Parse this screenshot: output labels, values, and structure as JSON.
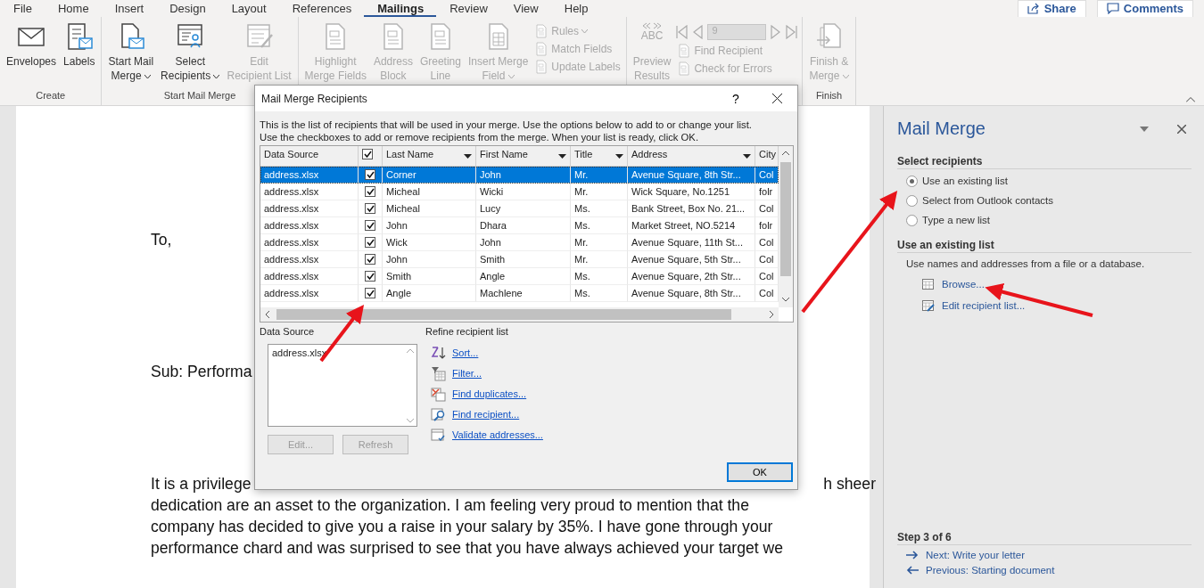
{
  "menu_tabs": [
    {
      "label": "File",
      "selected": false
    },
    {
      "label": "Home",
      "selected": false
    },
    {
      "label": "Insert",
      "selected": false
    },
    {
      "label": "Design",
      "selected": false
    },
    {
      "label": "Layout",
      "selected": false
    },
    {
      "label": "References",
      "selected": false
    },
    {
      "label": "Mailings",
      "selected": true
    },
    {
      "label": "Review",
      "selected": false
    },
    {
      "label": "View",
      "selected": false
    },
    {
      "label": "Help",
      "selected": false
    }
  ],
  "header_buttons": [
    {
      "label": "Share"
    },
    {
      "label": "Comments"
    }
  ],
  "ribbon_groups": [
    {
      "label": "Create",
      "commands": [
        {
          "kind": "large",
          "lines": [
            "Envelopes"
          ],
          "dropdown": false,
          "disabled": false
        },
        {
          "kind": "large",
          "lines": [
            "Labels"
          ],
          "dropdown": false,
          "disabled": false
        }
      ]
    },
    {
      "label": "Start Mail Merge",
      "commands": [
        {
          "kind": "large",
          "lines": [
            "Start Mail",
            "Merge"
          ],
          "dropdown": true,
          "disabled": false
        },
        {
          "kind": "large",
          "lines": [
            "Select",
            "Recipients"
          ],
          "dropdown": true,
          "disabled": false
        },
        {
          "kind": "large",
          "lines": [
            "Edit",
            "Recipient List"
          ],
          "dropdown": false,
          "disabled": true
        }
      ]
    },
    {
      "commands": [
        {
          "kind": "large",
          "lines": [
            "Highlight",
            "Merge Fields"
          ],
          "dropdown": false,
          "disabled": true
        },
        {
          "kind": "large",
          "lines": [
            "Address",
            "Block"
          ],
          "dropdown": false,
          "disabled": true
        },
        {
          "kind": "large",
          "lines": [
            "Greeting",
            "Line"
          ],
          "dropdown": false,
          "disabled": true
        },
        {
          "kind": "large",
          "lines": [
            "Insert Merge",
            "Field"
          ],
          "dropdown": true,
          "disabled": true
        },
        {
          "kind": "small",
          "lines": [
            "Rules"
          ],
          "dropdown": true,
          "disabled": true
        },
        {
          "kind": "small",
          "lines": [
            "Match Fields"
          ],
          "dropdown": false,
          "disabled": true
        },
        {
          "kind": "small",
          "lines": [
            "Update Labels"
          ],
          "dropdown": false,
          "disabled": true
        }
      ]
    },
    {
      "commands": [
        {
          "kind": "large",
          "badge": "ABC",
          "lines": [
            "Preview",
            "Results"
          ],
          "dropdown": false,
          "disabled": true
        },
        {
          "kind": "nav",
          "record": "9",
          "disabled": true
        },
        {
          "kind": "small",
          "lines": [
            "Find Recipient"
          ],
          "dropdown": false,
          "disabled": true
        },
        {
          "kind": "small",
          "lines": [
            "Check for Errors"
          ],
          "dropdown": false,
          "disabled": true
        }
      ]
    },
    {
      "label": "Finish",
      "commands": [
        {
          "kind": "large",
          "lines": [
            "Finish &",
            "Merge"
          ],
          "dropdown": true,
          "disabled": true
        }
      ]
    }
  ],
  "document": {
    "greeting": "To,",
    "subject": "Sub: Performa",
    "first_line_left": "It is a privilege",
    "first_line_right": "h sheer",
    "lines": [
      "dedication are an asset to the organization. I am feeling very proud to mention that the",
      "company has decided to give you a raise in your salary by 35%. I have gone through your",
      "performance chard and was surprised to see that you have always achieved your target we"
    ]
  },
  "dialog": {
    "title": "Mail Merge Recipients",
    "help": "?",
    "intro_lines": [
      "This is the list of recipients that will be used in your merge.  Use the options below to add to or change your list.",
      "Use the checkboxes to add or remove recipients from the merge.  When your list is ready, click OK."
    ],
    "columns": [
      {
        "label": "Data Source",
        "kind": "text",
        "sortable": false
      },
      {
        "kind": "check",
        "checked": true
      },
      {
        "label": "Last Name",
        "kind": "text",
        "sortable": true
      },
      {
        "label": "First Name",
        "kind": "text",
        "sortable": true
      },
      {
        "label": "Title",
        "kind": "text",
        "sortable": true
      },
      {
        "label": "Address",
        "kind": "text",
        "sortable": true
      },
      {
        "label": "City",
        "kind": "text",
        "sortable": false
      }
    ],
    "rows": [
      {
        "source": "address.xlsx",
        "checked": true,
        "last": "Corner",
        "first": "John",
        "title": "Mr.",
        "address": "Avenue Square, 8th Str...",
        "city": "Col",
        "selected": true
      },
      {
        "source": "address.xlsx",
        "checked": true,
        "last": "Micheal",
        "first": "Wicki",
        "title": "Mr.",
        "address": "Wick Square, No.1251",
        "city": "folr",
        "selected": false
      },
      {
        "source": "address.xlsx",
        "checked": true,
        "last": "Micheal",
        "first": "Lucy",
        "title": "Ms.",
        "address": "Bank Street, Box No. 21...",
        "city": "Col",
        "selected": false
      },
      {
        "source": "address.xlsx",
        "checked": true,
        "last": "John",
        "first": "Dhara",
        "title": "Ms.",
        "address": "Market Street, NO.5214",
        "city": "folr",
        "selected": false
      },
      {
        "source": "address.xlsx",
        "checked": true,
        "last": "Wick",
        "first": "John",
        "title": "Mr.",
        "address": "Avenue Square, 11th St...",
        "city": "Col",
        "selected": false
      },
      {
        "source": "address.xlsx",
        "checked": true,
        "last": "John",
        "first": "Smith",
        "title": "Mr.",
        "address": "Avenue Square, 5th Str...",
        "city": "Col",
        "selected": false
      },
      {
        "source": "address.xlsx",
        "checked": true,
        "last": "Smith",
        "first": "Angle",
        "title": "Ms.",
        "address": "Avenue Square, 2th Str...",
        "city": "Col",
        "selected": false
      },
      {
        "source": "address.xlsx",
        "checked": true,
        "last": "Angle",
        "first": "Machlene",
        "title": "Ms.",
        "address": "Avenue Square, 8th Str...",
        "city": "Col",
        "selected": false
      }
    ],
    "source_label": "Data Source",
    "sources": [
      "address.xlsx"
    ],
    "source_buttons": [
      {
        "label": "Edit...",
        "disabled": true
      },
      {
        "label": "Refresh",
        "disabled": true
      }
    ],
    "refine_label": "Refine recipient list",
    "refine_links": [
      "Sort...",
      "Filter...",
      "Find duplicates...",
      "Find recipient...",
      "Validate addresses..."
    ],
    "ok": "OK"
  },
  "pane": {
    "title": "Mail Merge",
    "section1": "Select recipients",
    "options": [
      {
        "label": "Use an existing list",
        "selected": true
      },
      {
        "label": "Select from Outlook contacts",
        "selected": false
      },
      {
        "label": "Type a new list",
        "selected": false
      }
    ],
    "section2": "Use an existing list",
    "description": "Use names and addresses from a file or a database.",
    "links": [
      "Browse...",
      "Edit recipient list..."
    ],
    "step": "Step 3 of 6",
    "nav": [
      "Next: Write your letter",
      "Previous: Starting document"
    ]
  }
}
